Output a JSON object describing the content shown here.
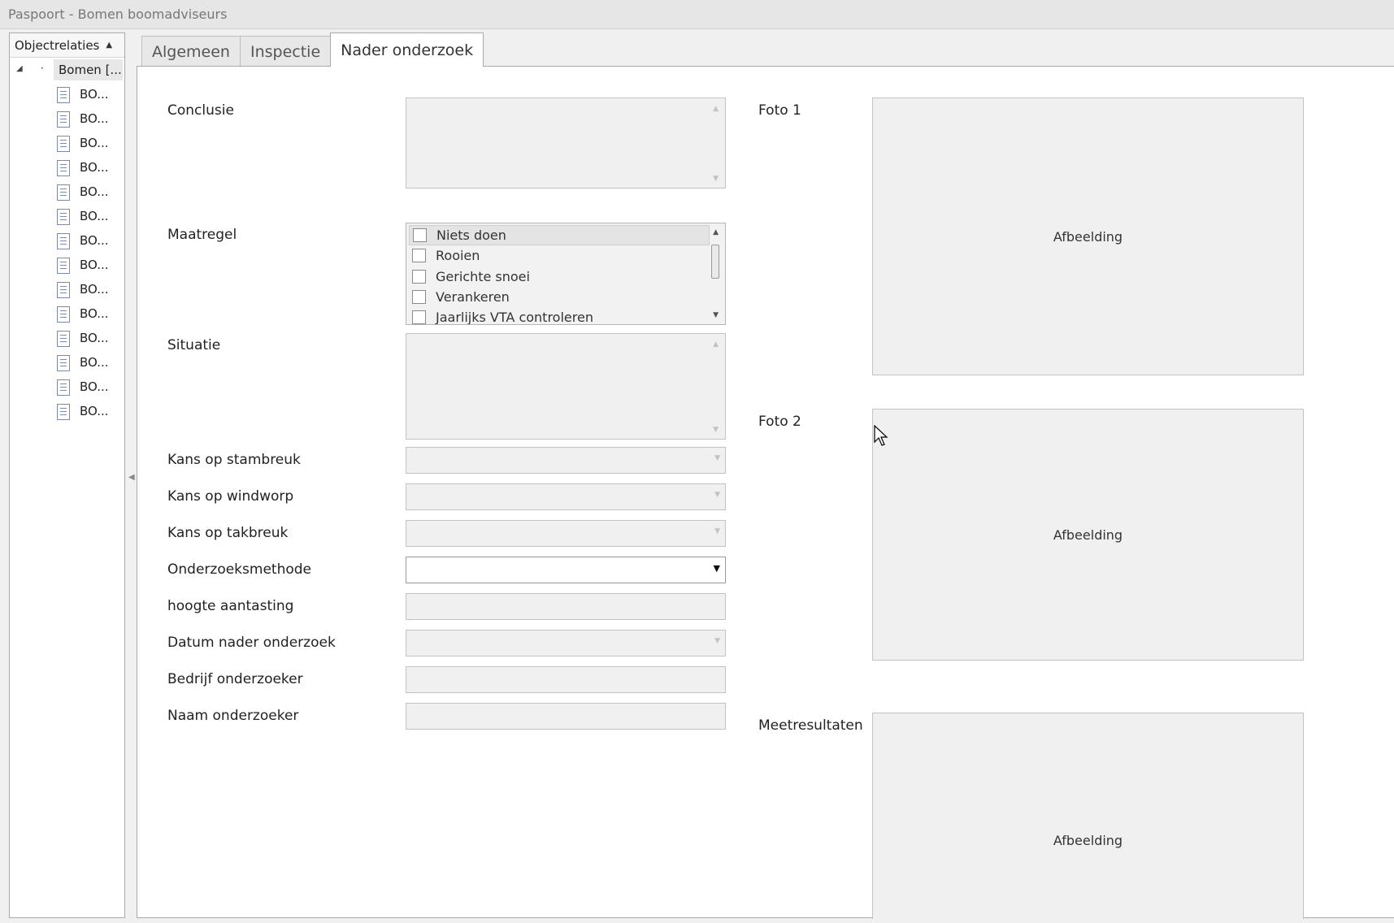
{
  "window": {
    "title": "Paspoort - Bomen boomadviseurs"
  },
  "sidebar": {
    "header": "Objectrelaties",
    "root_label": "Bomen [...",
    "children": [
      "BO...",
      "BO...",
      "BO...",
      "BO...",
      "BO...",
      "BO...",
      "BO...",
      "BO...",
      "BO...",
      "BO...",
      "BO...",
      "BO...",
      "BO...",
      "BO..."
    ]
  },
  "tabs": [
    {
      "label": "Algemeen",
      "active": false
    },
    {
      "label": "Inspectie",
      "active": false
    },
    {
      "label": "Nader onderzoek",
      "active": true
    }
  ],
  "form": {
    "conclusie": {
      "label": "Conclusie",
      "value": ""
    },
    "maatregel": {
      "label": "Maatregel",
      "options": [
        "Niets doen",
        "Rooien",
        "Gerichte snoei",
        "Verankeren",
        "Jaarlijks VTA controleren"
      ],
      "checked": [
        false,
        false,
        false,
        false,
        false
      ]
    },
    "situatie": {
      "label": "Situatie",
      "value": ""
    },
    "kans_stambreuk": {
      "label": "Kans op stambreuk",
      "value": ""
    },
    "kans_windworp": {
      "label": "Kans op windworp",
      "value": ""
    },
    "kans_takbreuk": {
      "label": "Kans op takbreuk",
      "value": ""
    },
    "onderzoeksmethode": {
      "label": "Onderzoeksmethode",
      "value": ""
    },
    "hoogte_aantasting": {
      "label": "hoogte aantasting",
      "value": ""
    },
    "datum_nader_onderzoek": {
      "label": "Datum nader onderzoek",
      "value": ""
    },
    "bedrijf_onderzoeker": {
      "label": "Bedrijf onderzoeker",
      "value": ""
    },
    "naam_onderzoeker": {
      "label": "Naam onderzoeker",
      "value": ""
    }
  },
  "images": {
    "foto1": {
      "label": "Foto 1",
      "placeholder": "Afbeelding"
    },
    "foto2": {
      "label": "Foto 2",
      "placeholder": "Afbeelding"
    },
    "meetresultaten": {
      "label": "Meetresultaten",
      "placeholder": "Afbeelding"
    }
  }
}
